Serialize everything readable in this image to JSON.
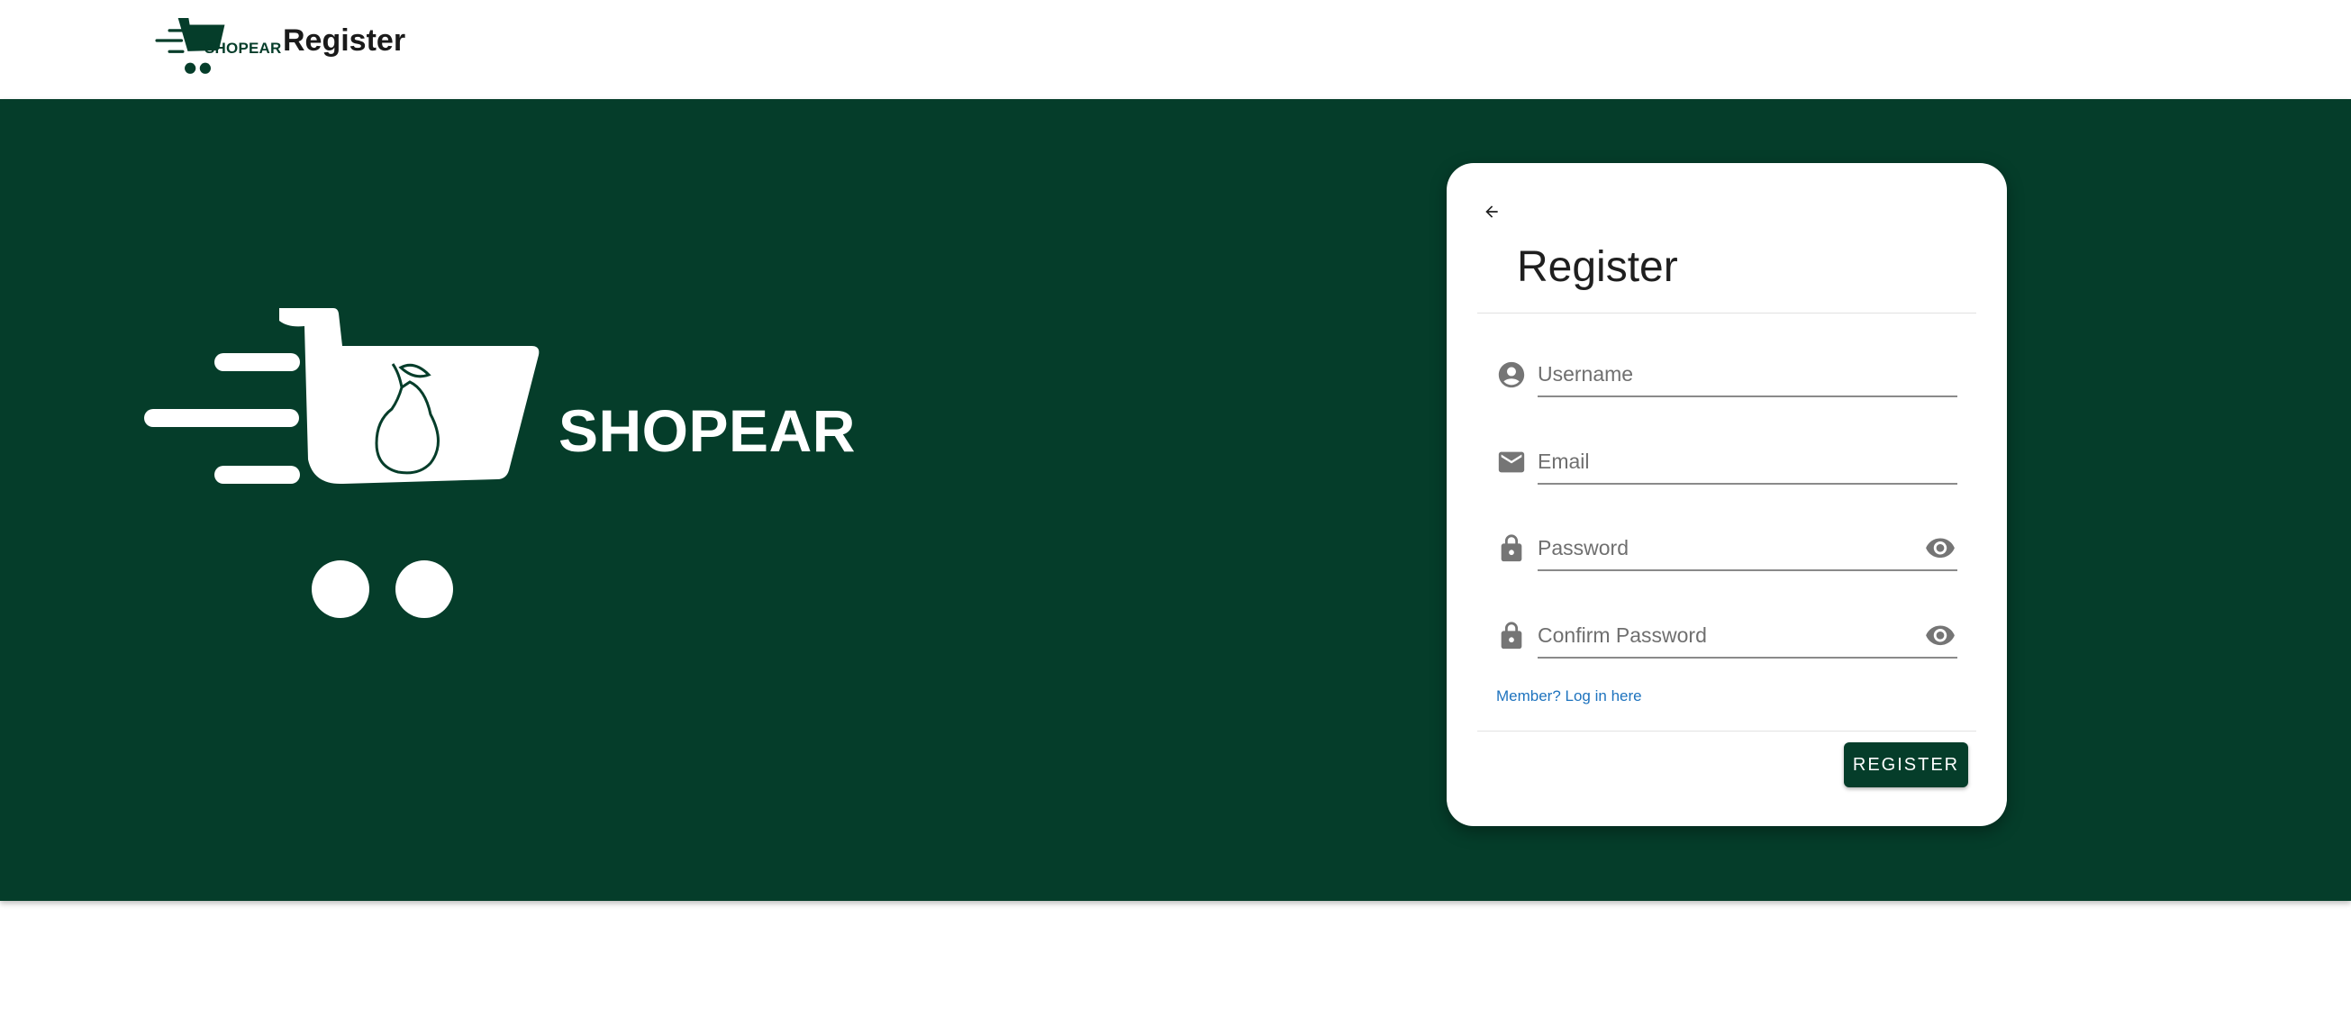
{
  "header": {
    "logo_text": "SHOPEAR",
    "title": "Register"
  },
  "hero": {
    "brand": "SHOPEAR"
  },
  "form": {
    "title": "Register",
    "username_placeholder": "Username",
    "email_placeholder": "Email",
    "password_placeholder": "Password",
    "confirm_password_placeholder": "Confirm Password",
    "login_link": "Member? Log in here",
    "register_button": "REGISTER"
  },
  "icons": {
    "back": "arrow-left-icon",
    "username": "account-circle-icon",
    "email": "mail-icon",
    "password": "lock-icon",
    "visibility": "eye-icon",
    "logo": "shopping-cart-pear-icon"
  },
  "colors": {
    "brand": "#053d2a",
    "link": "#1e73be",
    "icon": "#757575"
  }
}
